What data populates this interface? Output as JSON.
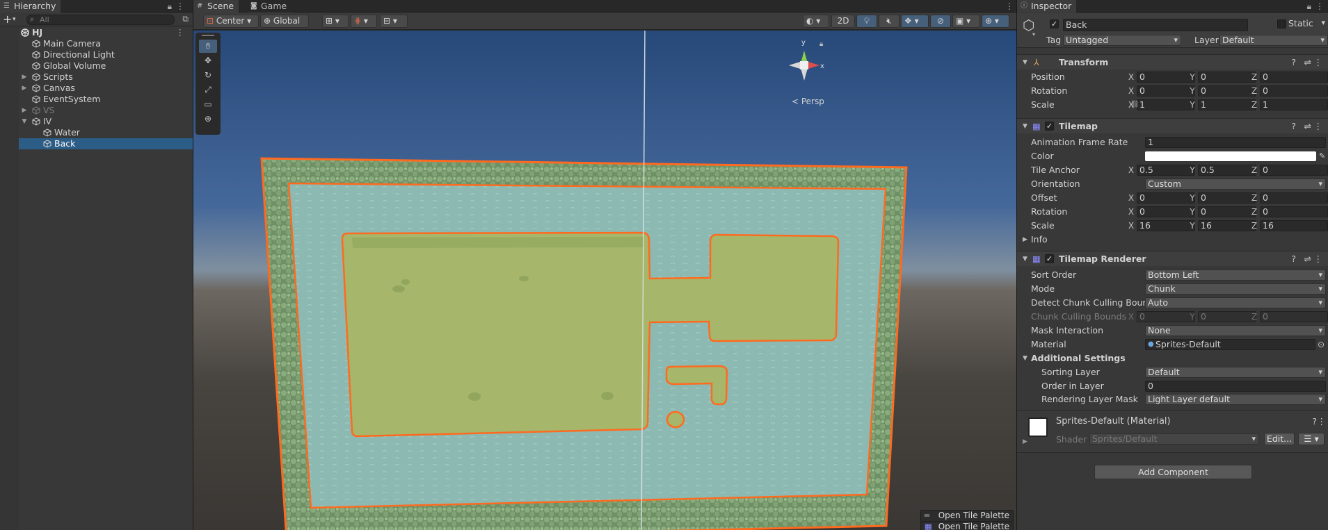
{
  "hierarchy": {
    "tab": "Hierarchy",
    "search_placeholder": "All",
    "add_label": "+",
    "items": [
      {
        "label": "HJ",
        "depth": 0,
        "arrow": "down",
        "icon": "unity-scene-icon",
        "bold": true
      },
      {
        "label": "Main Camera",
        "depth": 1,
        "arrow": "",
        "icon": "gameobject-cube-icon"
      },
      {
        "label": "Directional Light",
        "depth": 1,
        "arrow": "",
        "icon": "gameobject-cube-icon"
      },
      {
        "label": "Global Volume",
        "depth": 1,
        "arrow": "",
        "icon": "gameobject-cube-icon"
      },
      {
        "label": "Scripts",
        "depth": 1,
        "arrow": "right",
        "icon": "gameobject-cube-icon"
      },
      {
        "label": "Canvas",
        "depth": 1,
        "arrow": "right",
        "icon": "gameobject-cube-icon"
      },
      {
        "label": "EventSystem",
        "depth": 1,
        "arrow": "",
        "icon": "gameobject-cube-icon"
      },
      {
        "label": "VS",
        "depth": 1,
        "arrow": "right",
        "icon": "gameobject-cube-icon",
        "dim": true
      },
      {
        "label": "IV",
        "depth": 1,
        "arrow": "down",
        "icon": "gameobject-cube-icon"
      },
      {
        "label": "Water",
        "depth": 2,
        "arrow": "",
        "icon": "gameobject-cube-icon"
      },
      {
        "label": "Back",
        "depth": 2,
        "arrow": "",
        "icon": "gameobject-cube-icon",
        "selected": true
      }
    ]
  },
  "scene": {
    "tabs": [
      {
        "label": "Scene",
        "icon": "grid-icon"
      },
      {
        "label": "Game",
        "icon": "gamepad-icon"
      }
    ],
    "pivot": "Center",
    "space": "Global",
    "mode_2d": "2D",
    "persp": "< Persp",
    "gizmo_axes": {
      "y": "y",
      "x": "x"
    },
    "tool_palette": [
      "hand-tool",
      "move-tool",
      "rotate-tool",
      "scale-tool",
      "rect-tool",
      "transform-tool"
    ],
    "tile_palette_btn": "Open Tile Palette",
    "tile_palette_btn2": "Open Tile Palette"
  },
  "inspector": {
    "tab": "Inspector",
    "object_name": "Back",
    "static_label": "Static",
    "tag_label": "Tag",
    "tag_value": "Untagged",
    "layer_label": "Layer",
    "layer_value": "Default",
    "transform": {
      "title": "Transform",
      "position": {
        "label": "Position",
        "x": "0",
        "y": "0",
        "z": "0"
      },
      "rotation": {
        "label": "Rotation",
        "x": "0",
        "y": "0",
        "z": "0"
      },
      "scale": {
        "label": "Scale",
        "x": "1",
        "y": "1",
        "z": "1"
      }
    },
    "tilemap": {
      "title": "Tilemap",
      "frame_rate_label": "Animation Frame Rate",
      "frame_rate": "1",
      "color_label": "Color",
      "anchor": {
        "label": "Tile Anchor",
        "x": "0.5",
        "y": "0.5",
        "z": "0"
      },
      "orientation_label": "Orientation",
      "orientation": "Custom",
      "offset": {
        "label": "Offset",
        "x": "0",
        "y": "0",
        "z": "0"
      },
      "rotation": {
        "label": "Rotation",
        "x": "0",
        "y": "0",
        "z": "0"
      },
      "scale": {
        "label": "Scale",
        "x": "16",
        "y": "16",
        "z": "16"
      },
      "info": "Info"
    },
    "renderer": {
      "title": "Tilemap Renderer",
      "sort_order_label": "Sort Order",
      "sort_order": "Bottom Left",
      "mode_label": "Mode",
      "mode": "Chunk",
      "cull_label": "Detect Chunk Culling Bounds",
      "cull": "Auto",
      "cull_bounds": {
        "label": "Chunk Culling Bounds",
        "x": "0",
        "y": "0",
        "z": "0"
      },
      "mask_label": "Mask Interaction",
      "mask": "None",
      "material_label": "Material",
      "material": "Sprites-Default",
      "additional": "Additional Settings",
      "sorting_layer_label": "Sorting Layer",
      "sorting_layer": "Default",
      "order_label": "Order in Layer",
      "order": "0",
      "rlm_label": "Rendering Layer Mask",
      "rlm": "Light Layer default"
    },
    "material_block": {
      "title": "Sprites-Default (Material)",
      "shader_label": "Shader",
      "shader": "Sprites/Default",
      "edit": "Edit..."
    },
    "add_component": "Add Component"
  },
  "axis": {
    "x": "X",
    "y": "Y",
    "z": "Z"
  },
  "colors": {
    "selection": "#2c5d87",
    "tilemap_outline": "#ff6a1f",
    "water": "#8ab8b0",
    "grass": "#a9b86a"
  }
}
